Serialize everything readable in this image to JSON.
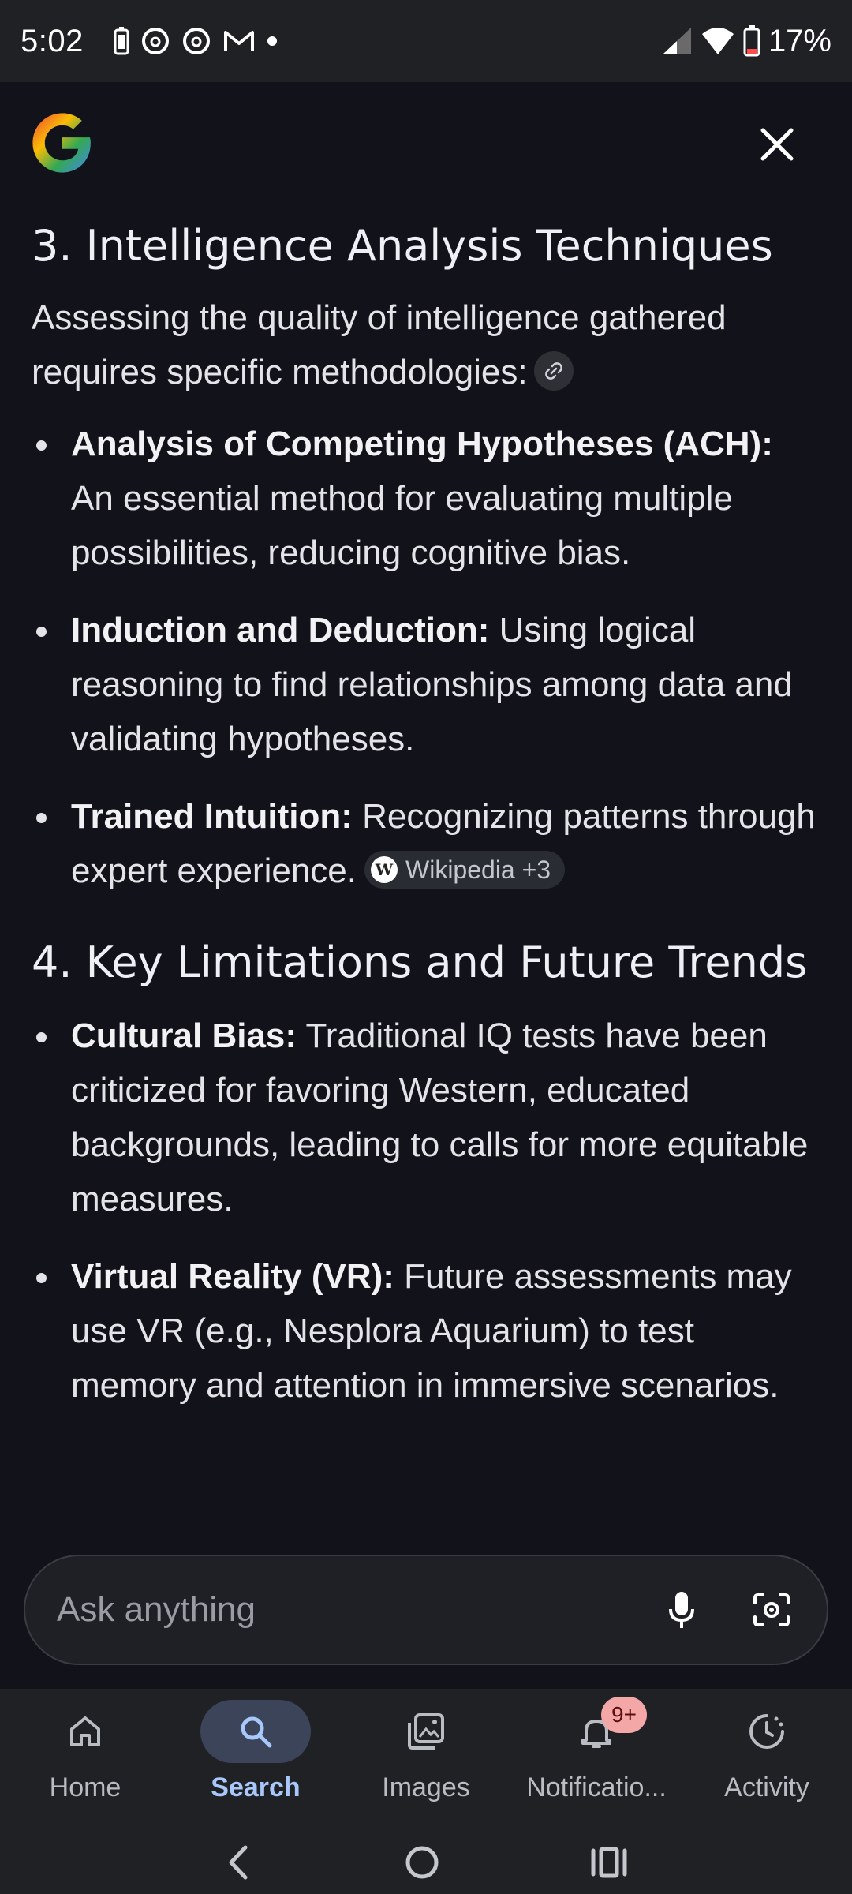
{
  "status_bar": {
    "time": "5:02",
    "battery_percent": "17%",
    "icons": [
      "battery-saver-icon",
      "threads-icon",
      "threads-icon",
      "gmail-icon",
      "dot-icon",
      "signal-icon",
      "wifi-icon",
      "battery-icon"
    ]
  },
  "header": {
    "logo": "google-g-logo",
    "close_icon": "close-icon"
  },
  "sections": {
    "s3": {
      "title": "3. Intelligence Analysis Techniques",
      "intro": "Assessing the quality of intelligence gathered requires specific methodologies:",
      "items": [
        {
          "bold": "Analysis of Competing Hypotheses (ACH):",
          "text": " An essential method for evaluating multiple possibilities, reducing cognitive bias."
        },
        {
          "bold": "Induction and Deduction:",
          "text": " Using logical reasoning to find relationships among data and validating hypotheses."
        },
        {
          "bold": "Trained Intuition:",
          "text": " Recognizing patterns through expert experience."
        }
      ],
      "source_chip": "Wikipedia +3"
    },
    "s4": {
      "title": "4. Key Limitations and Future Trends",
      "items": [
        {
          "bold": "Cultural Bias:",
          "text": " Traditional IQ tests have been criticized for favoring Western, educated backgrounds, leading to calls for more equitable measures."
        },
        {
          "bold": "Virtual Reality (VR):",
          "text": " Future assessments may use VR (e.g., Nesplora Aquarium) to test memory and attention in immersive scenarios."
        }
      ]
    }
  },
  "ask_bar": {
    "placeholder": "Ask anything"
  },
  "bottom_nav": {
    "items": [
      {
        "label": "Home",
        "icon": "home-icon"
      },
      {
        "label": "Search",
        "icon": "search-icon",
        "active": true
      },
      {
        "label": "Images",
        "icon": "images-icon"
      },
      {
        "label": "Notificatio...",
        "icon": "bell-icon",
        "badge": "9+"
      },
      {
        "label": "Activity",
        "icon": "activity-icon"
      }
    ]
  },
  "colors": {
    "background": "#12131a",
    "active_tab": "#a8c7fa",
    "badge": "#f4a7a7"
  }
}
